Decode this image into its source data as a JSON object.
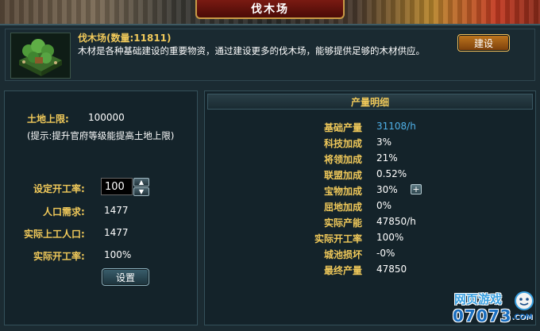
{
  "window": {
    "title": "伐木场"
  },
  "building": {
    "name": "伐木场(数量:11811)",
    "description": "木材是各种基础建设的重要物资，通过建设更多的伐木场，能够提供足够的木材供应。",
    "build_button": "建设"
  },
  "left": {
    "land_limit_label": "土地上限:",
    "land_limit_value": "100000",
    "hint": "(提示:提升官府等级能提高土地上限)",
    "work_rate_label": "设定开工率:",
    "work_rate_input": "100",
    "population_need_label": "人口需求:",
    "population_need_value": "1477",
    "actual_workers_label": "实际上工人口:",
    "actual_workers_value": "1477",
    "actual_rate_label": "实际开工率:",
    "actual_rate_value": "100%",
    "set_button": "设置"
  },
  "right": {
    "title": "产量明细",
    "rows": [
      {
        "label": "基础产量",
        "value": "31108/h"
      },
      {
        "label": "科技加成",
        "value": "3%"
      },
      {
        "label": "将领加成",
        "value": "21%"
      },
      {
        "label": "联盟加成",
        "value": "0.52%"
      },
      {
        "label": "宝物加成",
        "value": "30%"
      },
      {
        "label": "屈地加成",
        "value": "0%"
      },
      {
        "label": "实际产能",
        "value": "47850/h"
      },
      {
        "label": "实际开工率",
        "value": "100%"
      },
      {
        "label": "城池损坏",
        "value": "-0%"
      },
      {
        "label": "最终产量",
        "value": "47850"
      }
    ]
  },
  "watermark": {
    "line1": "网页游戏",
    "line2": "07073",
    "suffix": ".COM"
  },
  "colors": {
    "gold_label": "#f0c95a",
    "blue_value": "#4fb0e8",
    "panel_bg": "#14232a"
  }
}
